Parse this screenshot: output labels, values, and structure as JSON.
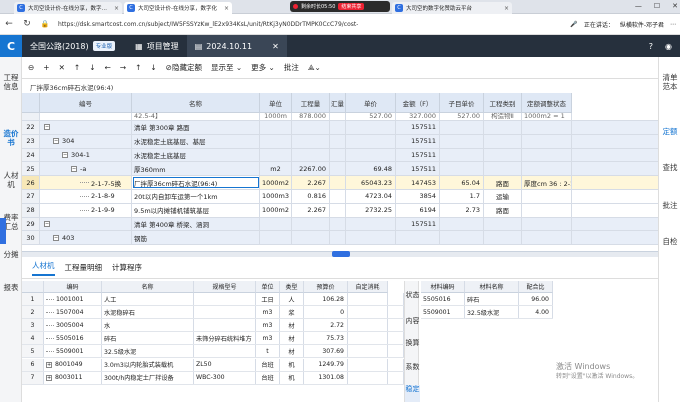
{
  "browser": {
    "tabs": [
      {
        "label": "大司空设计价-在线分享，数字助…",
        "icon": "C"
      },
      {
        "label": "大司空设计价-在线分享，数字化",
        "icon": "C"
      },
      {
        "label": "大司空的数字化赞助云平台",
        "icon": "C"
      }
    ],
    "recording": {
      "label": "剩余时长05:50",
      "end_label": "结束共享"
    },
    "url": "https://dsk.smartcost.com.cn/subject/IW5FSSYzKw_lE2x934KsL/unit/RtKj3yN0DDrTMPK0CcC79/cost-…",
    "address_right": {
      "status": "正在讲话：",
      "speaker": "纵横软件-邓子君"
    }
  },
  "app": {
    "logo": "C",
    "project_name": "全国公路(2018)",
    "edition_badge": "专业版",
    "tabs": [
      {
        "label": "项目管理",
        "icon": "grid-icon"
      },
      {
        "label": "2024.10.11",
        "icon": "document-icon"
      }
    ]
  },
  "toolbar": {
    "hide_quota": "隐藏定额",
    "display": "显示至",
    "more": "更多",
    "annotate": "批注"
  },
  "left_nav": [
    {
      "label": "工程\n信息",
      "active": false
    },
    {
      "label": "造价\n书",
      "active": true
    },
    {
      "label": "人材\n机",
      "active": false
    },
    {
      "label": "费率\n汇总",
      "active": false
    },
    {
      "label": "分摊",
      "active": false
    },
    {
      "label": "报表",
      "active": false
    }
  ],
  "right_nav": [
    {
      "label": "清单\n范本",
      "active": false
    },
    {
      "label": "定额",
      "active": true
    },
    {
      "label": "查找",
      "active": false
    },
    {
      "label": "批注",
      "active": false
    },
    {
      "label": "自检",
      "active": false
    }
  ],
  "breadcrumb": "厂拌厚36cm碎石水泥(96:4)",
  "grid": {
    "headers": [
      "编号",
      "名称",
      "单位",
      "工程量",
      "汇量",
      "单价",
      "金额（F）",
      "子目单价",
      "工程类别",
      "定额调整状态"
    ],
    "partial_row": {
      "name": "42.5-4】",
      "unit": "1000m",
      "qty": "878.000",
      "price": "527.00",
      "amount": "327.000",
      "sub": "527.00",
      "cat": "构造物Ⅱ",
      "status": "1000m2 = 1"
    },
    "rows": [
      {
        "no": "22",
        "code": "",
        "name": "清单 第300章 路面",
        "unit": "",
        "qty": "",
        "price": "",
        "amount": "157511",
        "sub": "",
        "cat": "",
        "status": "",
        "indent": 0,
        "tree": "−"
      },
      {
        "no": "23",
        "code": "304",
        "name": "水泥稳定土底基层、基层",
        "unit": "",
        "qty": "",
        "price": "",
        "amount": "157511",
        "sub": "",
        "cat": "",
        "status": "",
        "indent": 1,
        "tree": "−"
      },
      {
        "no": "24",
        "code": "304-1",
        "name": "水泥稳定土底基层",
        "unit": "",
        "qty": "",
        "price": "",
        "amount": "157511",
        "sub": "",
        "cat": "",
        "status": "",
        "indent": 2,
        "tree": "−"
      },
      {
        "no": "25",
        "code": "-a",
        "name": "厚360mm",
        "unit": "m2",
        "qty": "2267.00",
        "price": "69.48",
        "amount": "157511",
        "sub": "",
        "cat": "",
        "status": "",
        "indent": 3,
        "tree": "−"
      },
      {
        "no": "26",
        "code": "2-1-7-5换",
        "name": "厂拌厚36cm碎石水泥(96:4)",
        "unit": "1000m2",
        "qty": "2.267",
        "price": "65043.23",
        "amount": "147453",
        "sub": "65.04",
        "cat": "路面",
        "status": "厚度cm 36 : 2-1",
        "indent": 4,
        "tree": "",
        "selected": true
      },
      {
        "no": "27",
        "code": "2-1-8-9",
        "name": "20t以内自卸车运第一个1km",
        "unit": "1000m3",
        "qty": "0.816",
        "price": "4723.04",
        "amount": "3854",
        "sub": "1.7",
        "cat": "运输",
        "status": "",
        "indent": 4,
        "tree": "",
        "white": true
      },
      {
        "no": "28",
        "code": "2-1-9-9",
        "name": "9.5m以内摊铺机铺筑基层",
        "unit": "1000m2",
        "qty": "2.267",
        "price": "2732.25",
        "amount": "6194",
        "sub": "2.73",
        "cat": "路面",
        "status": "",
        "indent": 4,
        "tree": "",
        "white": true
      },
      {
        "no": "29",
        "code": "",
        "name": "清单 第400章 桥梁、涵洞",
        "unit": "",
        "qty": "",
        "price": "",
        "amount": "157511",
        "sub": "",
        "cat": "",
        "status": "",
        "indent": 0,
        "tree": "−"
      },
      {
        "no": "30",
        "code": "403",
        "name": "钢筋",
        "unit": "",
        "qty": "",
        "price": "",
        "amount": "",
        "sub": "",
        "cat": "",
        "status": "",
        "indent": 1,
        "tree": "−"
      }
    ]
  },
  "bottom_tabs": [
    "人材机",
    "工程量明细",
    "计算程序"
  ],
  "material_grid": {
    "headers": [
      "编码",
      "名称",
      "规格型号",
      "单位",
      "类型",
      "预算价",
      "自定消耗"
    ],
    "rows": [
      {
        "no": "1",
        "code": "1001001",
        "name": "人工",
        "spec": "",
        "unit": "工日",
        "type": "人",
        "price": "106.28",
        "expand": false
      },
      {
        "no": "2",
        "code": "1507004",
        "name": "水泥稳碎石",
        "spec": "",
        "unit": "m3",
        "type": "浆",
        "price": "0",
        "expand": false
      },
      {
        "no": "3",
        "code": "3005004",
        "name": "水",
        "spec": "",
        "unit": "m3",
        "type": "材",
        "price": "2.72",
        "expand": false
      },
      {
        "no": "4",
        "code": "5505016",
        "name": "碎石",
        "spec": "未筛分碎石统料堆方",
        "unit": "m3",
        "type": "材",
        "price": "75.73",
        "expand": false
      },
      {
        "no": "5",
        "code": "5509001",
        "name": "32.5级水泥",
        "spec": "",
        "unit": "t",
        "type": "材",
        "price": "307.69",
        "expand": false
      },
      {
        "no": "6",
        "code": "8001049",
        "name": "3.0m3以内轮胎式装载机",
        "spec": "ZL50",
        "unit": "台班",
        "type": "机",
        "price": "1249.79",
        "expand": true
      },
      {
        "no": "7",
        "code": "8003011",
        "name": "300t/h内稳定土厂拌设备",
        "spec": "WBC-300",
        "unit": "台班",
        "type": "机",
        "price": "1301.08",
        "expand": true
      }
    ]
  },
  "side_tabs": [
    {
      "label": "状态",
      "active": false
    },
    {
      "label": "内容",
      "active": false
    },
    {
      "label": "换算",
      "active": false
    },
    {
      "label": "系数",
      "active": false
    },
    {
      "label": "稳定",
      "active": true
    }
  ],
  "ratio_grid": {
    "headers": [
      "材料编码",
      "材料名称",
      "配合比"
    ],
    "rows": [
      {
        "code": "5505016",
        "name": "碎石",
        "ratio": "96.00"
      },
      {
        "code": "5509001",
        "name": "32.5级水泥",
        "ratio": "4.00"
      }
    ]
  },
  "watermark": {
    "line1": "激活 Windows",
    "line2": "转到\"设置\"以激活 Windows。"
  },
  "colors": {
    "accent": "#1675d1",
    "header_dark": "#26303d",
    "selected_row": "#fff7da",
    "group_row": "#e8eef8"
  }
}
